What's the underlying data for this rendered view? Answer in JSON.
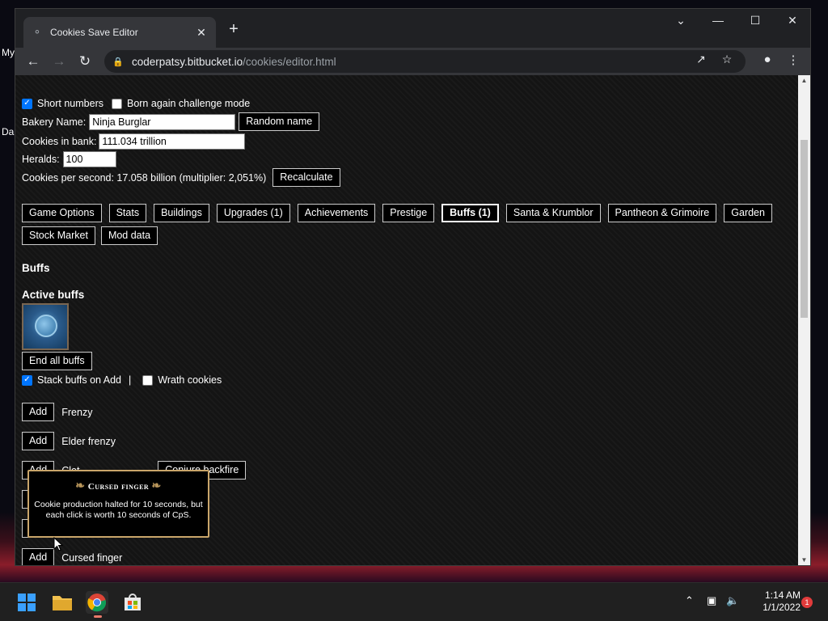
{
  "desktop": {
    "label_my": "My",
    "label_da": "Da"
  },
  "browser": {
    "tab_title": "Cookies Save Editor",
    "url_host": "coderpatsy.bitbucket.io",
    "url_path": "/cookies/editor.html"
  },
  "editor": {
    "short_numbers_label": "Short numbers",
    "short_numbers_checked": true,
    "born_again_label": "Born again challenge mode",
    "born_again_checked": false,
    "bakery_name_label": "Bakery Name:",
    "bakery_name_value": "Ninja Burglar",
    "random_name_label": "Random name",
    "cookies_bank_label": "Cookies in bank:",
    "cookies_bank_value": "111.034 trillion",
    "heralds_label": "Heralds:",
    "heralds_value": "100",
    "cps_text": "Cookies per second: 17.058 billion (multiplier: 2,051%)",
    "recalculate_label": "Recalculate",
    "tabs": [
      "Game Options",
      "Stats",
      "Buildings",
      "Upgrades (1)",
      "Achievements",
      "Prestige",
      "Buffs (1)",
      "Santa & Krumblor",
      "Pantheon & Grimoire",
      "Garden",
      "Stock Market",
      "Mod data"
    ],
    "active_tab": "Buffs (1)",
    "section_title": "Buffs",
    "active_buffs_title": "Active buffs",
    "end_all_buffs_label": "End all buffs",
    "stack_buffs_label": "Stack buffs on Add",
    "stack_buffs_checked": true,
    "separator": "|",
    "wrath_cookies_label": "Wrath cookies",
    "wrath_cookies_checked": false,
    "add_label": "Add",
    "buff_rows": [
      {
        "name": "Frenzy"
      },
      {
        "name": "Elder frenzy"
      },
      {
        "name": "Clot",
        "extra_button": "Conjure backfire"
      },
      {
        "name": "Cursed finger"
      }
    ]
  },
  "tooltip": {
    "title": "Cursed finger",
    "description": "Cookie production halted for 10 seconds, but each click is worth 10 seconds of CpS."
  },
  "taskbar": {
    "time": "1:14 AM",
    "date": "1/1/2022",
    "notification_count": "1"
  }
}
